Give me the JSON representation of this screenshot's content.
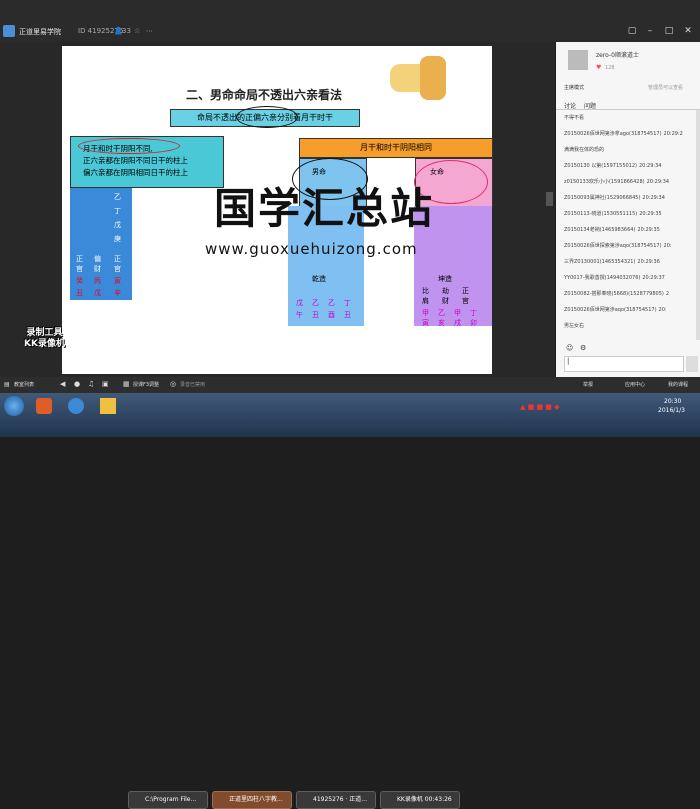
{
  "titlebar": {
    "app_name": "正道里易学院",
    "room_id": "ID 41925276",
    "viewers": "33"
  },
  "slide": {
    "heading": "二、男命命局不透出六亲看法",
    "box_top": "命局不透出的正偏六亲分别看月干时干",
    "box_left_title": "月干和时干阴阳不同,",
    "box_left_line1": "正六亲都在阴阳不同日干的柱上",
    "box_left_line2": "偏六亲都在阴阳相同日干的柱上",
    "box_right_title": "月干和时干阴阳相同",
    "male_label": "男命",
    "female_label": "女命",
    "left_chart": {
      "col1": [
        "伤",
        "财",
        "伤",
        "杀",
        "正",
        "官",
        "癸",
        "丑"
      ],
      "col2": [
        "乙",
        "丁",
        "戊",
        "庚",
        "偏",
        "财",
        "丙",
        "戊"
      ],
      "col3": [
        "正",
        "官",
        "寅",
        "辛"
      ],
      "label_ke": "克",
      "label_zao": "造"
    },
    "mid_chart": {
      "title": "乾造",
      "stems": [
        "戊",
        "乙",
        "乙",
        "丁"
      ],
      "branches": [
        "午",
        "丑",
        "酉",
        "丑"
      ],
      "labels": [
        "甲",
        "丙",
        "乙",
        "己"
      ],
      "labels2": [
        "辛",
        "戊",
        "癸"
      ]
    },
    "right_chart": {
      "title": "坤造",
      "stems": [
        "甲",
        "乙",
        "甲",
        "丁"
      ],
      "branches": [
        "寅",
        "亥",
        "戌",
        "卯"
      ],
      "labels": [
        "比",
        "劫",
        "正"
      ],
      "labels2": [
        "肩",
        "财",
        "官"
      ],
      "side": [
        "丁",
        "庚",
        "己",
        "乙"
      ]
    }
  },
  "watermark": {
    "text": "国学汇总站",
    "url": "www.guoxuehuizong.com"
  },
  "recorder_badge": {
    "line1": "录制工具",
    "line2": "KK录像机"
  },
  "sidebar": {
    "host_name": "zero-0顺滚道士",
    "likes": "128",
    "host_mode": "主席模式",
    "manage_link": "管理员可以查看",
    "tabs": [
      "讨论",
      "问题"
    ],
    "messages": [
      {
        "user": "不得不看",
        "text": ""
      },
      {
        "user": "Z0150026佰世网第涉拿ago(318754517)",
        "text": "20:29:2"
      },
      {
        "user": "满满我在体的恐的",
        "text": ""
      },
      {
        "user": "Z0150130 以第(1597155012)",
        "text": "20:29:34"
      },
      {
        "user": "z0150133欢乐小小(1591866428)",
        "text": "20:29:34"
      },
      {
        "user": "Z0150093属神社(1529066845)",
        "text": "20:29:34"
      },
      {
        "user": "Z0150113-晓道(1530551115)",
        "text": "20:29:35"
      },
      {
        "user": "Z0150134老衲(1465983664)",
        "text": "20:29:35"
      },
      {
        "user": "Z0150026佰世探索第涉aqo(318754517)",
        "text": "20:"
      },
      {
        "user": "三界Z0130001(1465354321)",
        "text": "20:29:36"
      },
      {
        "user": "YY0017-我歌善撰(1494032076)",
        "text": "20:29:37"
      },
      {
        "user": "Z0150082-搭那奉晓(5668)(1528779805)",
        "text": "2"
      },
      {
        "user": "Z0150026佰世网第涉aqo(318754517)",
        "text": "20:"
      },
      {
        "user": "男左女右",
        "text": ""
      }
    ],
    "input_placeholder": "|",
    "bottom_links": [
      "举报",
      "应用中心",
      "我的课程"
    ]
  },
  "bottombar": {
    "items": [
      "教室列表",
      "",
      "",
      "",
      "",
      "授课F3调整",
      "",
      "录音已禁用"
    ]
  },
  "taskbar": {
    "windows": [
      "C:\\Program File...",
      "正道里四柱八字教...",
      "41925276 · 正道...",
      "KK录像机 00:43:26"
    ],
    "clock_time": "20:30",
    "clock_date": "2016/1/3"
  }
}
